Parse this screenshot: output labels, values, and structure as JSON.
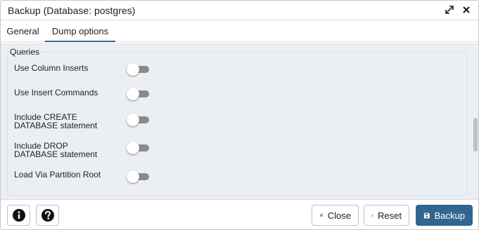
{
  "window": {
    "title": "Backup (Database: postgres)",
    "maximize_icon": "expand-arrows-icon",
    "close_icon": "close-x-icon"
  },
  "tabs": [
    {
      "label": "General",
      "active": false
    },
    {
      "label": "Dump options",
      "active": true
    }
  ],
  "section": {
    "legend": "Queries",
    "options": [
      {
        "label_lines": [
          "Use Column Inserts"
        ],
        "enabled": false
      },
      {
        "label_lines": [
          "Use Insert Commands"
        ],
        "enabled": false
      },
      {
        "label_lines": [
          "Include CREATE",
          "DATABASE statement"
        ],
        "enabled": false
      },
      {
        "label_lines": [
          "Include DROP",
          "DATABASE statement"
        ],
        "enabled": false
      },
      {
        "label_lines": [
          "Load Via Partition Root"
        ],
        "enabled": false
      }
    ]
  },
  "footer": {
    "info_icon": "info-icon",
    "help_icon": "help-question-icon",
    "close_label": "Close",
    "reset_label": "Reset",
    "backup_label": "Backup"
  },
  "colors": {
    "accent": "#326690",
    "content_bg": "#ebeef3",
    "toggle_off": "#8a8a8a"
  }
}
